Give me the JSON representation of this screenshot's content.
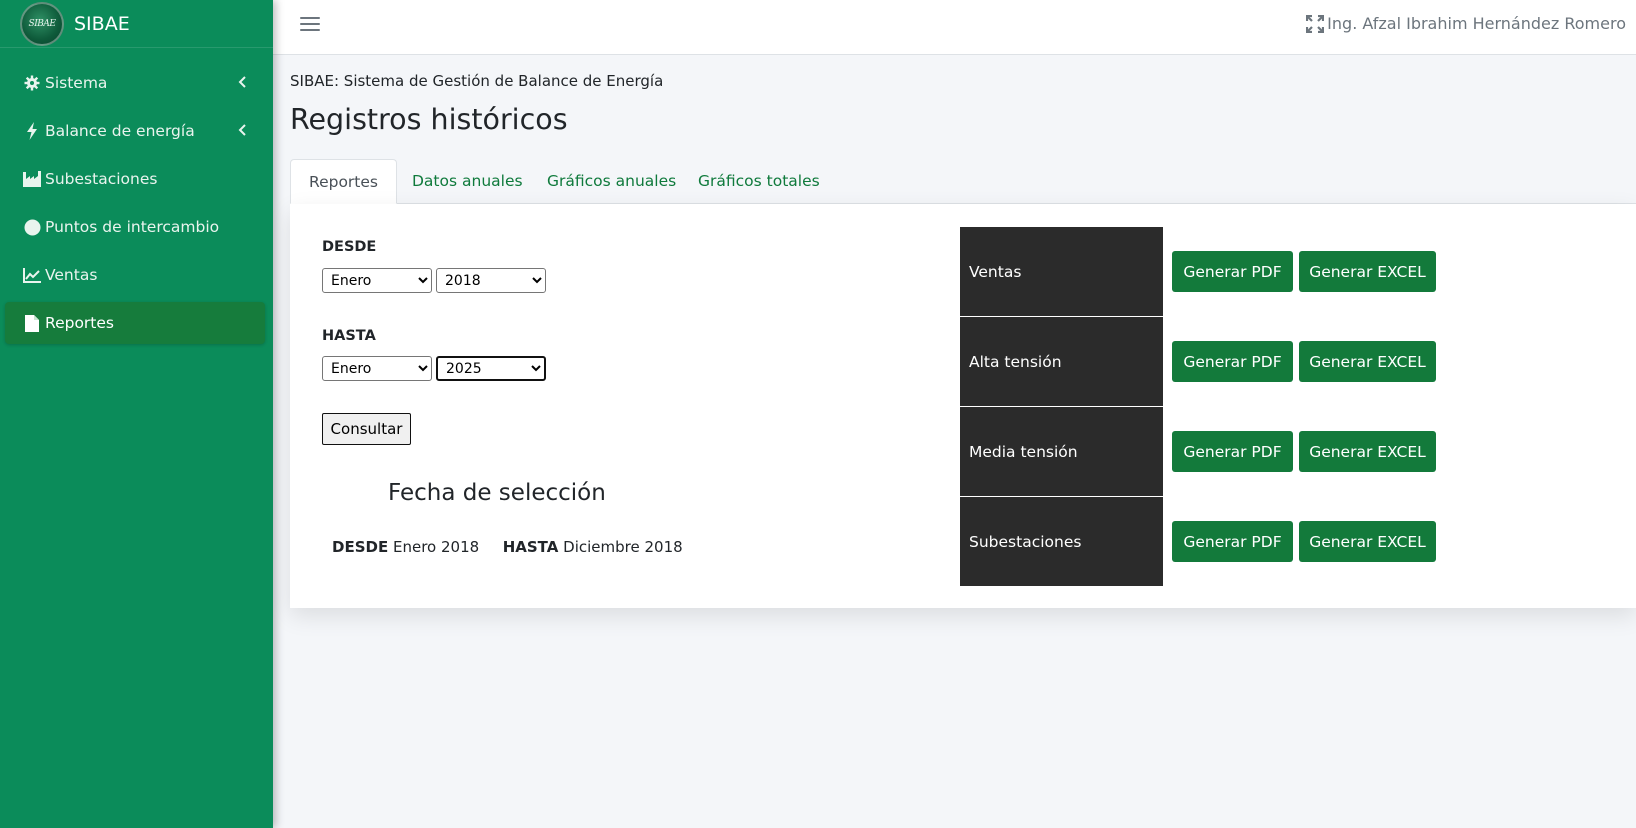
{
  "brand": {
    "logo_text": "SIBAE",
    "name": "SIBAE"
  },
  "sidebar": {
    "items": [
      {
        "label": "Sistema",
        "icon": "gear-icon",
        "chevron": true,
        "active": false
      },
      {
        "label": "Balance de energía",
        "icon": "bolt-icon",
        "chevron": true,
        "active": false
      },
      {
        "label": "Subestaciones",
        "icon": "industry-icon",
        "chevron": false,
        "active": false
      },
      {
        "label": "Puntos de intercambio",
        "icon": "circle-icon",
        "chevron": false,
        "active": false
      },
      {
        "label": "Ventas",
        "icon": "chart-line-icon",
        "chevron": false,
        "active": false
      },
      {
        "label": "Reportes",
        "icon": "file-icon",
        "chevron": false,
        "active": true
      }
    ]
  },
  "header": {
    "user": "Ing. Afzal Ibrahim Hernández Romero"
  },
  "page": {
    "breadcrumb": "SIBAE: Sistema de Gestión de Balance de Energía",
    "title": "Registros históricos"
  },
  "tabs": [
    "Reportes",
    "Datos anuales",
    "Gráficos anuales",
    "Gráficos totales"
  ],
  "form": {
    "desde_label": "DESDE",
    "hasta_label": "HASTA",
    "desde_month": "Enero",
    "desde_year": "2018",
    "hasta_month": "Enero",
    "hasta_year": "2025",
    "consultar": "Consultar"
  },
  "selection": {
    "title": "Fecha de selección",
    "desde_label": "DESDE",
    "desde_value": "Enero 2018",
    "hasta_label": "HASTA",
    "hasta_value": "Diciembre 2018"
  },
  "reports": [
    {
      "label": "Ventas",
      "pdf": "Generar PDF",
      "excel": "Generar EXCEL"
    },
    {
      "label": "Alta tensión",
      "pdf": "Generar PDF",
      "excel": "Generar EXCEL"
    },
    {
      "label": "Media tensión",
      "pdf": "Generar PDF",
      "excel": "Generar EXCEL"
    },
    {
      "label": "Subestaciones",
      "pdf": "Generar PDF",
      "excel": "Generar EXCEL"
    }
  ],
  "colors": {
    "sidebar": "#0b8c5a",
    "active_item": "#167c3c",
    "button_green": "#137a3b",
    "tab_link": "#0f7a3c",
    "report_label_bg": "#2b2b2b"
  }
}
